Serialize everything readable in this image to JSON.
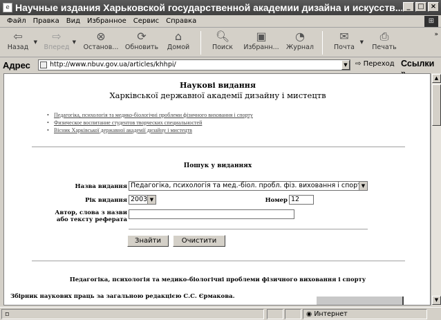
{
  "window": {
    "title": "Научные издания Харьковской государственной академии дизайна и искусств..."
  },
  "menu": {
    "items": [
      "Файл",
      "Правка",
      "Вид",
      "Избранное",
      "Сервис",
      "Справка"
    ]
  },
  "toolbar": {
    "back": "Назад",
    "forward": "Вперед",
    "stop": "Останов...",
    "refresh": "Обновить",
    "home": "Домой",
    "search": "Поиск",
    "favorites": "Избранн...",
    "history": "Журнал",
    "mail": "Почта",
    "print": "Печать"
  },
  "address": {
    "label": "Адрес",
    "url": "http://www.nbuv.gov.ua/articles/khhpi/",
    "go": "Переход",
    "links": "Ссылки"
  },
  "page": {
    "heading1": "Наукові видання",
    "heading2": "Харківської державної академії дизайну і мистецтв",
    "links": [
      "Педагогіка, психологія та медико-біологічні проблеми фізичного виховання і спорту",
      "Физическое воспитание студентов творческих специальностей",
      "Вісник Харківської державної академії дизайну і мистецтв"
    ],
    "search_title": "Пошук у виданнях",
    "form": {
      "edition_label": "Назва видання",
      "edition_value": "Педагогіка, психологія та мед.-біол. пробл. фіз. виховання і спорту",
      "year_label": "Рік видання",
      "year_value": "2003",
      "number_label": "Номер",
      "number_value": "12",
      "author_label_1": "Автор, слова з назви",
      "author_label_2": "або тексту реферата",
      "author_value": "",
      "find_button": "Знайти",
      "clear_button": "Очистити"
    },
    "section_title": "Педагогіка, психологія та медико-біологічні проблеми фізичного виховання і спорту",
    "collection": "Збірник наукових праць за загальною редакцією С.С. Єрмакова."
  },
  "status": {
    "zone": "Интернет"
  }
}
